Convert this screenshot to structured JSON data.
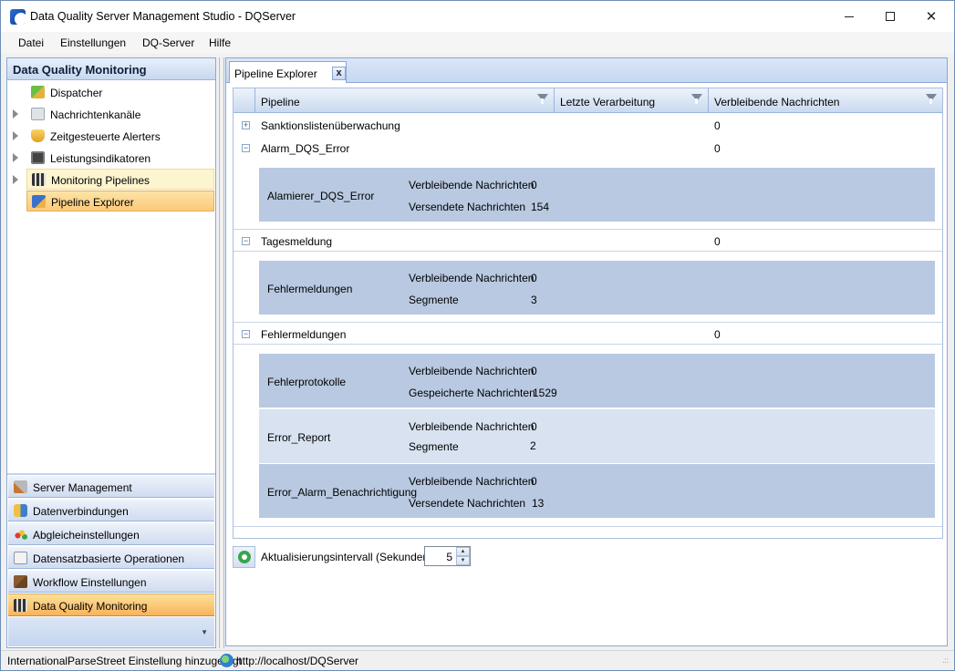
{
  "window": {
    "title": "Data Quality Server Management Studio - DQServer",
    "controls": {
      "minimize": "–",
      "maximize": "☐",
      "close": "✕"
    }
  },
  "menu": [
    "Datei",
    "Einstellungen",
    "DQ-Server",
    "Hilfe"
  ],
  "left_panel": {
    "header": "Data Quality Monitoring",
    "tree": [
      {
        "label": "Dispatcher",
        "icon": "puzzle-icon",
        "expandable": false
      },
      {
        "label": "Nachrichtenkanäle",
        "icon": "envelope-icon",
        "expandable": true
      },
      {
        "label": "Zeitgesteuerte Alerters",
        "icon": "shield-icon",
        "expandable": true
      },
      {
        "label": "Leistungsindikatoren",
        "icon": "monitor-icon",
        "expandable": true
      },
      {
        "label": "Monitoring Pipelines",
        "icon": "film-icon",
        "expandable": true,
        "state": "hover"
      },
      {
        "label": "Pipeline Explorer",
        "icon": "pipeline-icon",
        "expandable": false,
        "state": "selected"
      }
    ],
    "splitter_grip": "....",
    "nav_buttons": [
      {
        "label": "Server Management",
        "icon": "wrench-icon"
      },
      {
        "label": "Datenverbindungen",
        "icon": "database-icon"
      },
      {
        "label": "Abgleicheinstellungen",
        "icon": "balls-icon"
      },
      {
        "label": "Datensatzbasierte Operationen",
        "icon": "operations-icon"
      },
      {
        "label": "Workflow Einstellungen",
        "icon": "box-icon"
      },
      {
        "label": "Data Quality Monitoring",
        "icon": "film-icon",
        "active": true
      }
    ],
    "footer_chevron": "▼"
  },
  "main": {
    "tab": {
      "label": "Pipeline Explorer",
      "close": "x"
    },
    "grid": {
      "columns": [
        "Pipeline",
        "Letzte Verarbeitung",
        "Verbleibende Nachrichten"
      ],
      "rows": [
        {
          "pipeline": "Sanktionslistenüberwachung",
          "last": "",
          "remaining": "0",
          "toggle": "+",
          "details": []
        },
        {
          "pipeline": "Alarm_DQS_Error",
          "last": "",
          "remaining": "0",
          "toggle": "−",
          "details": [
            {
              "name": "Alamierer_DQS_Error",
              "k1": "Verbleibende Nachrichten",
              "v1": "0",
              "k2": "Versendete Nachrichten",
              "v2": "154"
            }
          ]
        },
        {
          "pipeline": "Tagesmeldung",
          "last": "",
          "remaining": "0",
          "toggle": "−",
          "details": [
            {
              "name": "Fehlermeldungen",
              "k1": "Verbleibende Nachrichten",
              "v1": "0",
              "k2": "Segmente",
              "v2": "3"
            }
          ]
        },
        {
          "pipeline": "Fehlermeldungen",
          "last": "",
          "remaining": "0",
          "toggle": "−",
          "details": [
            {
              "name": "Fehlerprotokolle",
              "k1": "Verbleibende Nachrichten",
              "v1": "0",
              "k2": "Gespeicherte Nachrichten",
              "v2": "1529"
            },
            {
              "name": "Error_Report",
              "k1": "Verbleibende Nachrichten",
              "v1": "0",
              "k2": "Segmente",
              "v2": "2"
            },
            {
              "name": "Error_Alarm_Benachrichtigung",
              "k1": "Verbleibende Nachrichten",
              "v1": "0",
              "k2": "Versendete Nachrichten",
              "v2": "13"
            }
          ]
        }
      ]
    },
    "refresh": {
      "label": "Aktualisierungsintervall (Sekunden):",
      "value": "5",
      "up": "▲",
      "down": "▼"
    }
  },
  "status": {
    "message": "InternationalParseStreet Einstellung hinzugefügt",
    "url": "http://localhost/DQServer",
    "grip": ".::"
  }
}
